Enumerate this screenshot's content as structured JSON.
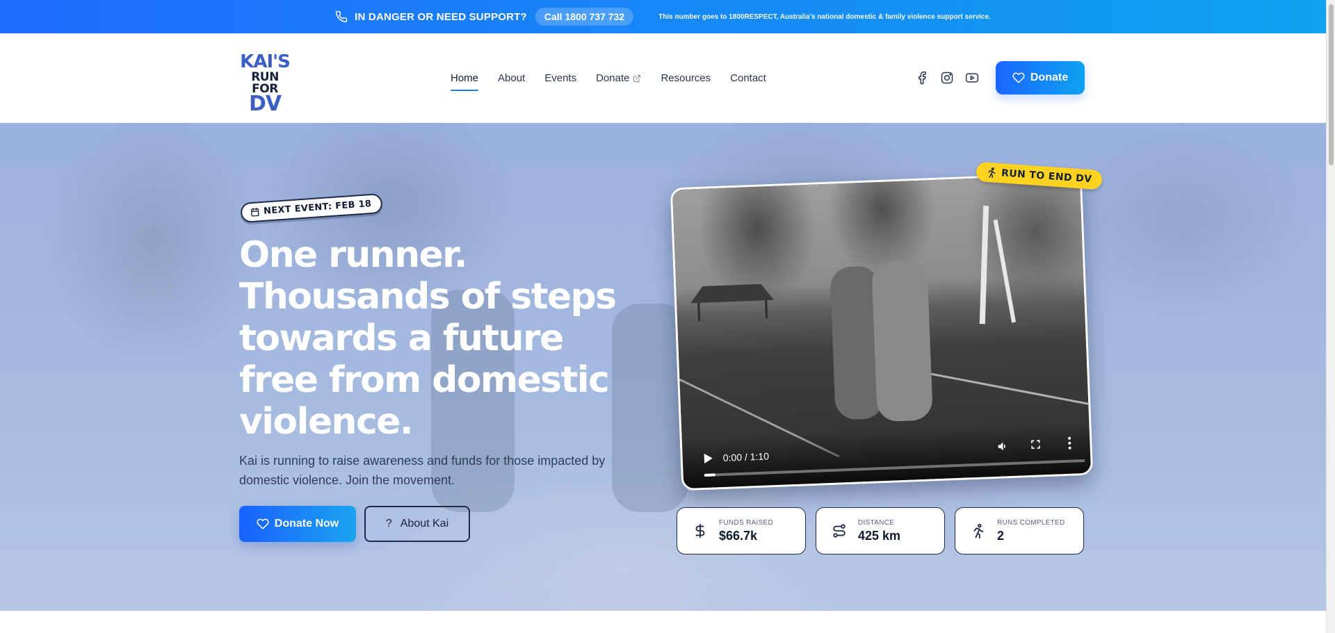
{
  "support_bar": {
    "danger_text": "IN DANGER OR NEED SUPPORT?",
    "call_label": "Call 1800 737 732",
    "note": "This number goes to 1800RESPECT, Australia's national domestic & family violence support service."
  },
  "logo": {
    "line1": "KAI'S",
    "line2": "RUN FOR",
    "line3": "DV"
  },
  "nav": {
    "items": [
      {
        "label": "Home",
        "active": true
      },
      {
        "label": "About"
      },
      {
        "label": "Events"
      },
      {
        "label": "Donate",
        "external": true
      },
      {
        "label": "Resources"
      },
      {
        "label": "Contact"
      }
    ]
  },
  "header": {
    "donate_label": "Donate"
  },
  "hero": {
    "event_tag": "NEXT EVENT: FEB 18",
    "headline": "One runner. Thousands of steps towards a future free from domestic violence.",
    "subtext": "Kai is running to raise awareness and funds for those impacted by domestic violence. Join the movement.",
    "donate_now_label": "Donate Now",
    "about_label": "About Kai",
    "about_icon_glyph": "?",
    "badge": "RUN TO END DV",
    "video": {
      "time": "0:00 / 1:10",
      "progress": 0.03
    }
  },
  "stats": [
    {
      "label": "FUNDS RAISED",
      "value": "$66.7k",
      "icon": "dollar-icon"
    },
    {
      "label": "DISTANCE",
      "value": "425 km",
      "icon": "route-icon"
    },
    {
      "label": "RUNS COMPLETED",
      "value": "2",
      "icon": "runner-icon"
    }
  ],
  "colors": {
    "accent_blue": "#1f6bff",
    "accent_cyan": "#0ea2ef",
    "badge_yellow": "#ffd21f",
    "ink": "#1f2a48"
  }
}
